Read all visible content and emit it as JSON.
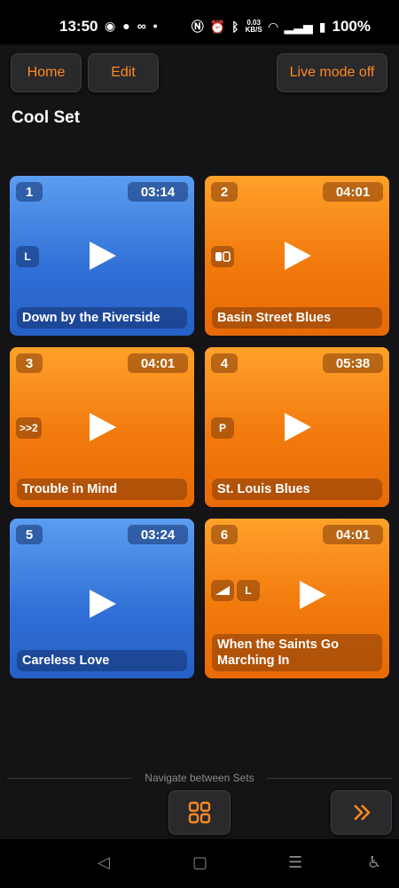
{
  "status": {
    "time": "13:50",
    "net_speed_value": "0.03",
    "net_speed_unit": "KB/S",
    "battery": "100%"
  },
  "toolbar": {
    "home_label": "Home",
    "edit_label": "Edit",
    "live_mode_label": "Live mode off"
  },
  "set": {
    "title": "Cool Set"
  },
  "songs": [
    {
      "number": "1",
      "duration": "03:14",
      "mode": "L",
      "title": "Down by the Riverside",
      "color": "#3a7de0"
    },
    {
      "number": "2",
      "duration": "04:01",
      "mode": "",
      "title": "Basin Street Blues",
      "color": "#f57f12"
    },
    {
      "number": "3",
      "duration": "04:01",
      "mode": ">>2",
      "title": "Trouble in Mind",
      "color": "#f57f12"
    },
    {
      "number": "4",
      "duration": "05:38",
      "mode": "P",
      "title": "St. Louis Blues",
      "color": "#f57f12"
    },
    {
      "number": "5",
      "duration": "03:24",
      "mode": "",
      "title": "Careless Love",
      "color": "#3a7de0"
    },
    {
      "number": "6",
      "duration": "04:01",
      "mode": "L",
      "title": "When the Saints Go Marching In",
      "color": "#f57f12"
    }
  ],
  "navigation": {
    "label": "Navigate between Sets"
  },
  "colors": {
    "accent": "#ff8a1f",
    "background": "#141316",
    "blue_tile": "#3a7de0",
    "orange_tile": "#f57f12"
  }
}
